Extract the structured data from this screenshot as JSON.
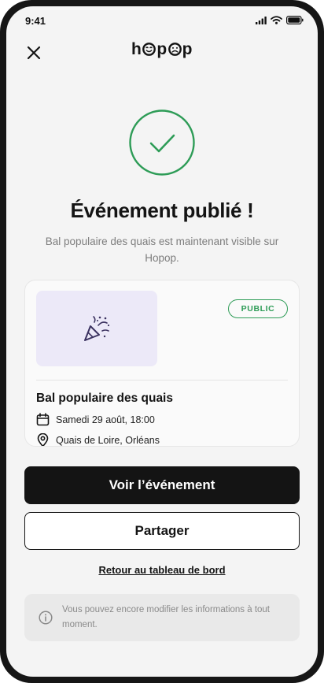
{
  "status_bar": {
    "time": "9:41"
  },
  "header": {
    "brand": {
      "letter_1": "h",
      "letter_2": "p",
      "letter_3": "p"
    }
  },
  "confirmation": {
    "title": "Événement publié !",
    "subtitle": "Bal populaire des quais est maintenant visible sur Hopop."
  },
  "event_card": {
    "visibility_badge": "PUBLIC",
    "name": "Bal populaire des quais",
    "date": "Samedi 29 août, 18:00",
    "location": "Quais de Loire, Orléans"
  },
  "actions": {
    "view_event": "Voir l’événement",
    "share": "Partager",
    "back_to_dashboard": "Retour au tableau de bord"
  },
  "notice": {
    "text": "Vous pouvez encore modifier les informations à tout moment."
  },
  "colors": {
    "success_green": "#2e9c57",
    "primary_dark": "#141414",
    "thumb_lavender": "#ece9f8",
    "muted_text": "#7d7d7d"
  },
  "icons": [
    "close-icon",
    "check-icon",
    "party-popper-icon",
    "calendar-icon",
    "location-pin-icon",
    "info-icon",
    "signal-icon",
    "wifi-icon",
    "battery-icon"
  ]
}
